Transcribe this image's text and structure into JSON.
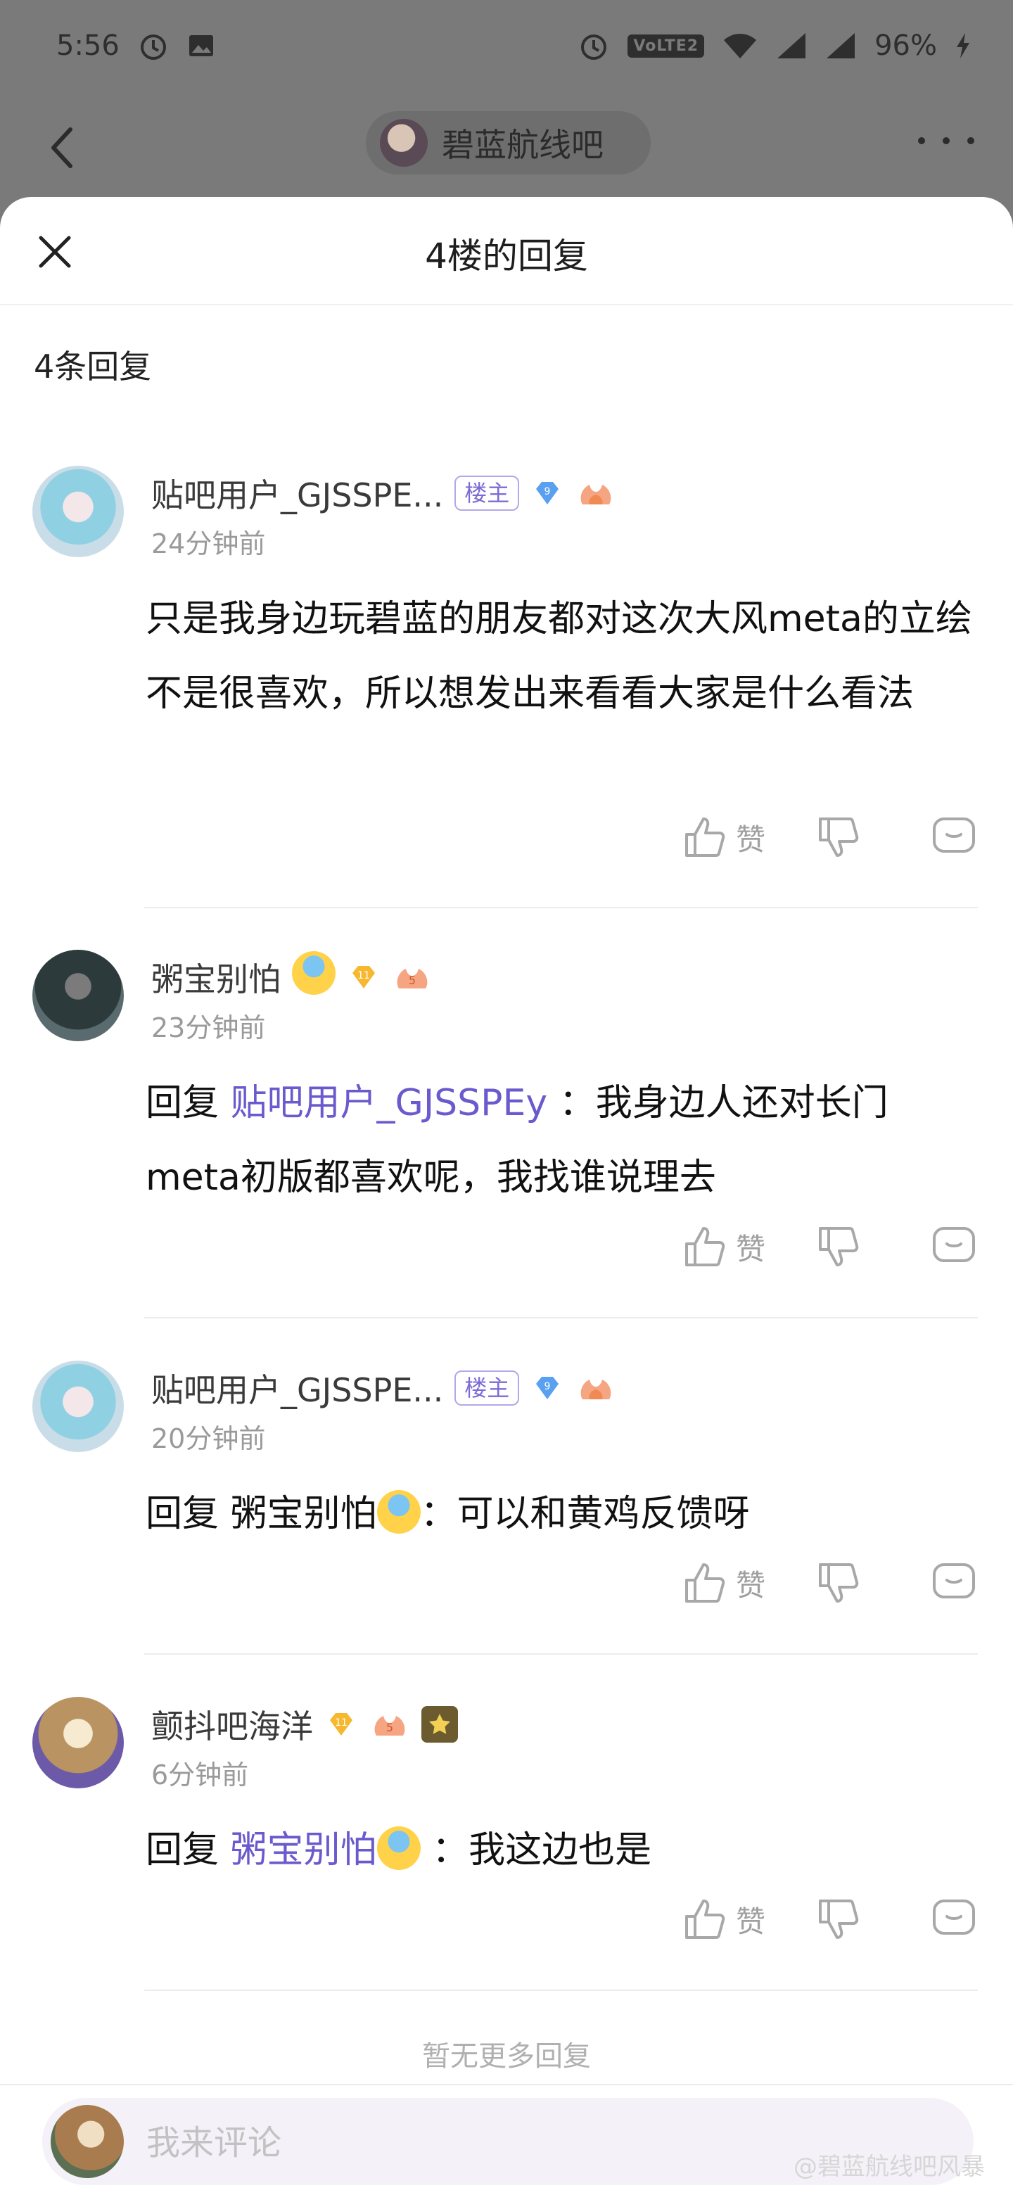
{
  "status_bar": {
    "time": "5:56",
    "battery": "96%",
    "network": "VoLTE2"
  },
  "forum": {
    "name": "碧蓝航线吧"
  },
  "sheet": {
    "title": "4楼的回复",
    "count_label": "4条回复",
    "no_more": "暂无更多回复",
    "comment_placeholder": "我来评论",
    "watermark": "@碧蓝航线吧风暴"
  },
  "replies": [
    {
      "username": "贴吧用户_GJSSPE...",
      "host_badge": "楼主",
      "level": "9",
      "time": "24分钟前",
      "content": "只是我身边玩碧蓝的朋友都对这次大风meta的立绘不是很喜欢，所以想发出来看看大家是什么看法",
      "like_label": "赞"
    },
    {
      "username": "粥宝别怕",
      "level": "11",
      "flame_level": "5",
      "time": "23分钟前",
      "reply_prefix": "回复 ",
      "reply_to": "贴吧用户_GJSSPEy",
      "content": " ：我身边人还对长门meta初版都喜欢呢，我找谁说理去",
      "like_label": "赞"
    },
    {
      "username": "贴吧用户_GJSSPE...",
      "host_badge": "楼主",
      "level": "9",
      "time": "20分钟前",
      "reply_prefix": "回复 ",
      "reply_to": "粥宝别怕",
      "content": "：可以和黄鸡反馈呀",
      "like_label": "赞"
    },
    {
      "username": "颤抖吧海洋",
      "level": "11",
      "flame_level": "5",
      "time": "6分钟前",
      "reply_prefix": "回复 ",
      "reply_to": "粥宝别怕",
      "content": " ：我这边也是",
      "like_label": "赞"
    }
  ],
  "colors": {
    "link": "#6a5acd",
    "host_badge": "#7d6bd6",
    "diamond_blue": "#5aa0f0",
    "diamond_gold": "#f5b82e",
    "flame": "#f08a55"
  }
}
